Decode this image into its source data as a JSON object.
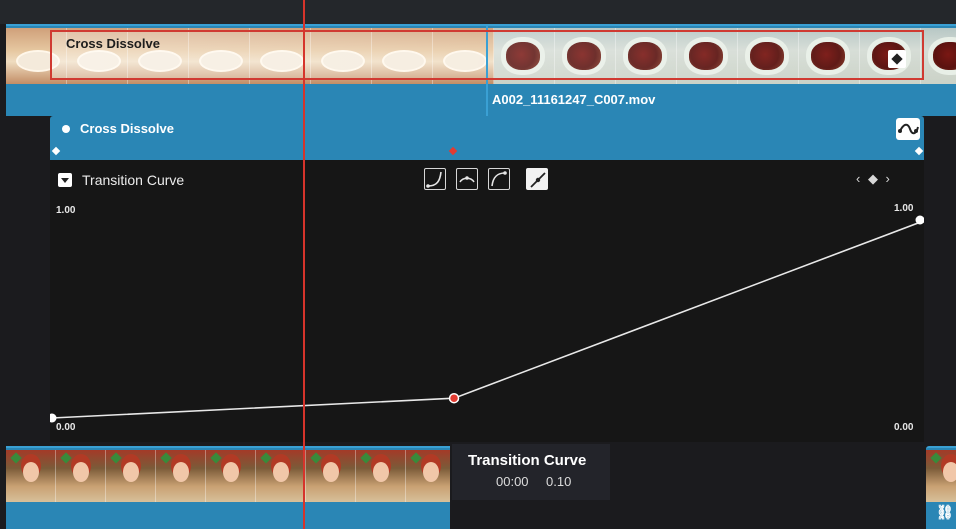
{
  "timeline": {
    "transition_label": "Cross Dissolve",
    "clip_name": "A002_11161247_C007.mov"
  },
  "inspector": {
    "title": "Cross Dissolve",
    "curve_header": "Transition Curve",
    "nav_arrows": "‹ ◆ ›",
    "y_top_left": "1.00",
    "y_top_right": "1.00",
    "y_bottom_left": "0.00",
    "y_bottom_right": "0.00",
    "presets": [
      {
        "icon": "ease-in-curve-icon"
      },
      {
        "icon": "ease-out-curve-icon"
      },
      {
        "icon": "ease-in-out-curve-icon"
      },
      {
        "icon": "linear-curve-icon",
        "active": true
      }
    ],
    "curve_points": [
      {
        "time": 0.0,
        "value": 0.0
      },
      {
        "time": 0.46,
        "value": 0.1
      },
      {
        "time": 1.0,
        "value": 1.0
      }
    ]
  },
  "tooltip": {
    "title": "Transition Curve",
    "time": "00:00",
    "value": "0.10"
  },
  "colors": {
    "track_blue": "#2a86b5",
    "playhead_red": "#d6342b",
    "keyframe_red": "#e23b31",
    "graph_bg": "#161616"
  },
  "icons": {
    "link": "link-icon",
    "keyframe_badge": "keyframe-diamond-icon"
  }
}
